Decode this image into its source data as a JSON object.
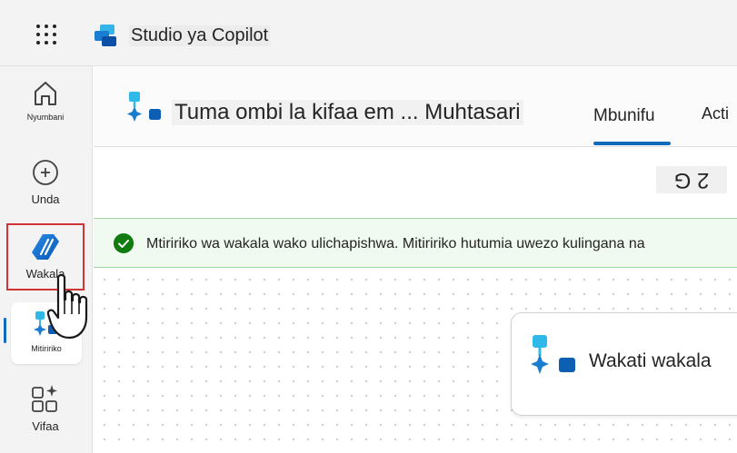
{
  "app": {
    "title": "Studio ya Copilot"
  },
  "nav": {
    "items": [
      {
        "label": "Nyumbani"
      },
      {
        "label": "Unda"
      },
      {
        "label": "Wakala"
      },
      {
        "label": "Mitiririko"
      },
      {
        "label": "Vifaa"
      }
    ]
  },
  "header": {
    "flow_title": "Tuma ombi la kifaa em ... Muhtasari",
    "tab_designer": "Mbunifu",
    "tab_activity": "Acti",
    "flipped_text": "2 G"
  },
  "banner": {
    "message": "Mtiririko wa wakala wako ulichapishwa. Mitiririko hutumia uwezo kulingana na"
  },
  "canvas": {
    "node_label": "Wakati wakala"
  },
  "colors": {
    "accent": "#0f6cbd",
    "success": "#107c10",
    "highlight": "#d13438"
  }
}
